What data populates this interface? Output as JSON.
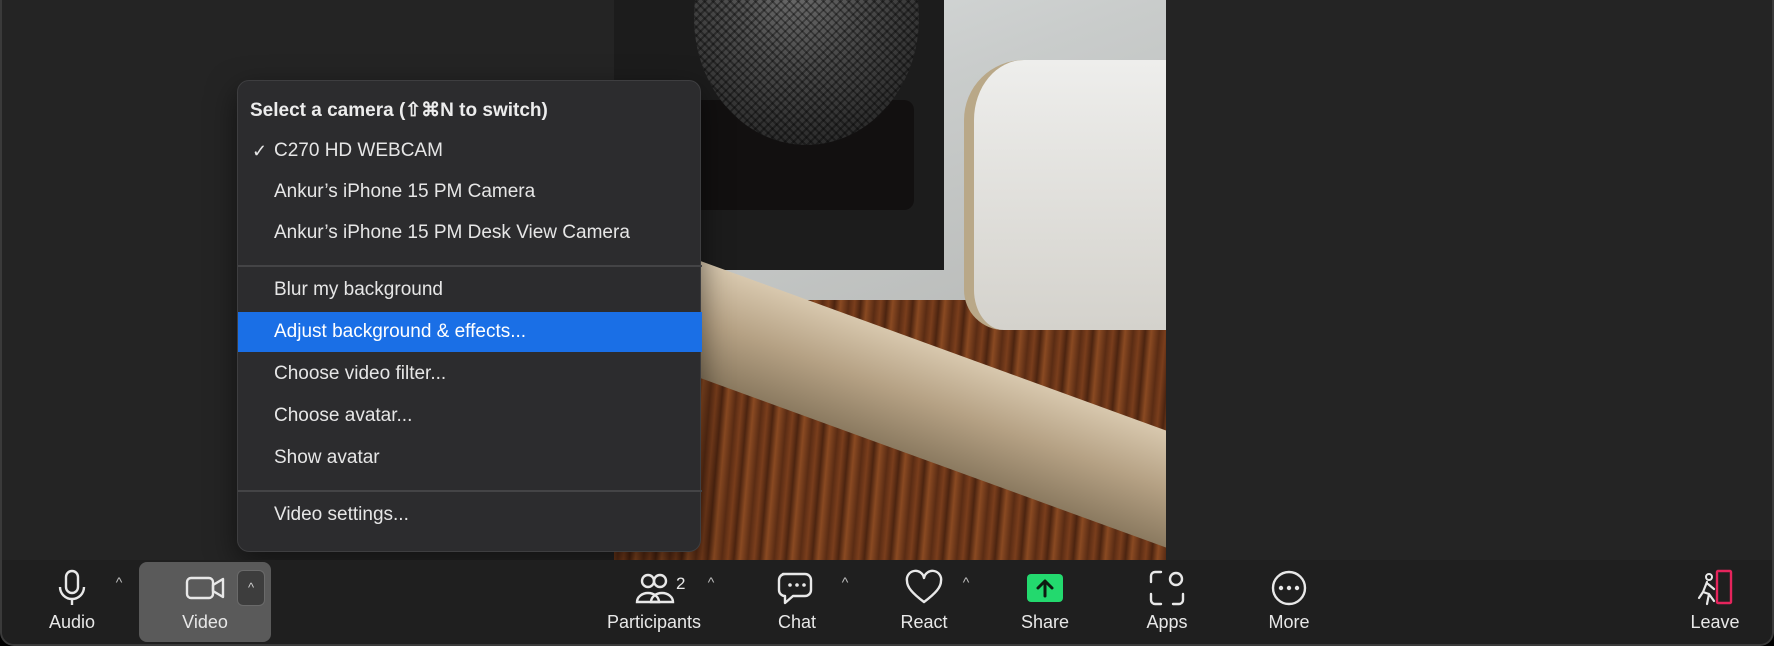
{
  "menu": {
    "title": "Select a camera (⇧⌘N to switch)",
    "cameras": [
      {
        "label": "C270 HD WEBCAM",
        "checked": true
      },
      {
        "label": "Ankur’s iPhone 15 PM Camera",
        "checked": false
      },
      {
        "label": "Ankur’s iPhone 15 PM Desk View Camera",
        "checked": false
      }
    ],
    "checkmark": "✓",
    "options": [
      {
        "label": "Blur my background"
      },
      {
        "label": "Adjust background & effects...",
        "highlighted": true
      },
      {
        "label": "Choose video filter..."
      },
      {
        "label": "Choose avatar..."
      },
      {
        "label": "Show avatar"
      }
    ],
    "settings": {
      "label": "Video settings..."
    },
    "highlight_color": "#1a6fe6"
  },
  "toolbar": {
    "audio": {
      "label": "Audio",
      "icon": "microphone-icon"
    },
    "video": {
      "label": "Video",
      "icon": "video-camera-icon"
    },
    "participants": {
      "label": "Participants",
      "icon": "participants-icon",
      "count": "2"
    },
    "chat": {
      "label": "Chat",
      "icon": "chat-icon"
    },
    "react": {
      "label": "React",
      "icon": "heart-icon"
    },
    "share": {
      "label": "Share",
      "icon": "share-screen-icon",
      "color": "#23d96e"
    },
    "apps": {
      "label": "Apps",
      "icon": "apps-icon"
    },
    "more": {
      "label": "More",
      "icon": "more-icon"
    },
    "leave": {
      "label": "Leave",
      "icon": "leave-icon",
      "color": "#e5245c"
    },
    "caret": "^"
  }
}
